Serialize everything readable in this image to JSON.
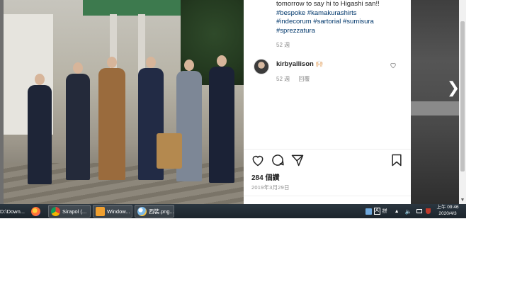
{
  "caption": {
    "line1": "tomorrow to say hi to Higashi san!!",
    "line2_tags": [
      "#bespoke",
      "#kamakurashirts"
    ],
    "line3_tags": [
      "#indecorum",
      "#sartorial",
      "#sumisura"
    ],
    "line4_tags": [
      "#sprezzatura"
    ],
    "time": "52 週"
  },
  "comment": {
    "username": "kirbyallison",
    "text": "🙌🏻",
    "time": "52 週",
    "reply": "回覆"
  },
  "post": {
    "likes": "284 個讚",
    "date": "2019年3月29日"
  },
  "taskbar": {
    "items": [
      {
        "label": "D:\\Down..."
      },
      {
        "label": ""
      },
      {
        "label": "Sirapol (..."
      },
      {
        "label": "Window..."
      },
      {
        "label": "西裝.png..."
      }
    ],
    "tray": {
      "ime": "A",
      "lang": "拼"
    },
    "clock_time": "上午 09:46",
    "clock_date": "2020/4/3"
  },
  "icons": {
    "next": "chevron-right-icon",
    "like": "heart-icon",
    "comment": "comment-icon",
    "share": "paper-plane-icon",
    "save": "bookmark-icon"
  }
}
